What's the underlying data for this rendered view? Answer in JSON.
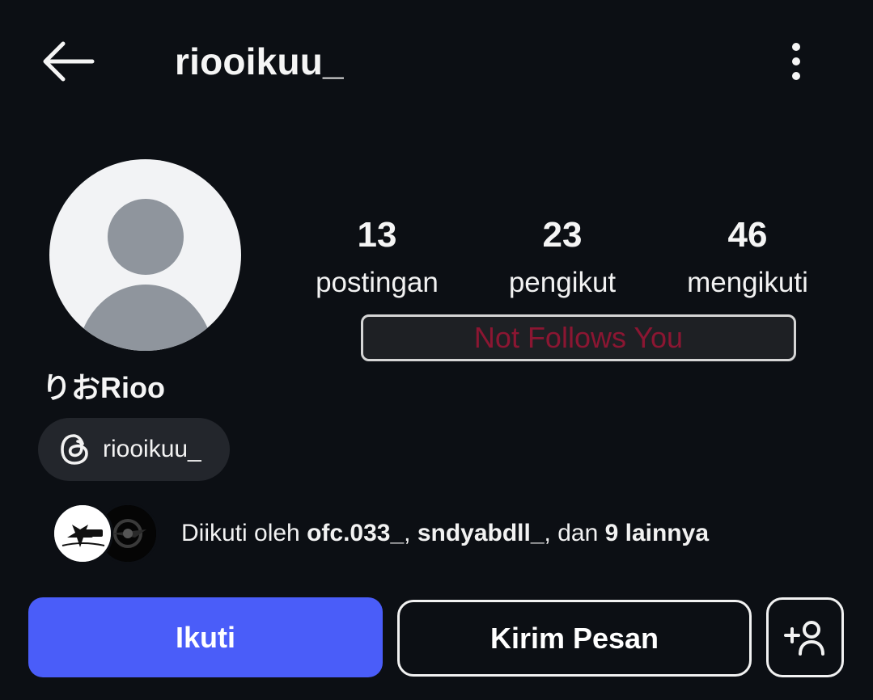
{
  "header": {
    "back_icon": "arrow-left-icon",
    "username": "riooikuu_",
    "more_icon": "vertical-ellipsis-icon"
  },
  "profile": {
    "avatar_icon": "default-avatar-icon",
    "display_name": "りおRioo",
    "threads": {
      "icon": "threads-icon",
      "handle": "riooikuu_"
    }
  },
  "stats": [
    {
      "value": "13",
      "label": "postingan"
    },
    {
      "value": "23",
      "label": "pengikut"
    },
    {
      "value": "46",
      "label": "mengikuti"
    }
  ],
  "follow_status": {
    "text": "Not Follows You",
    "color": "#8b1632"
  },
  "followed_by": {
    "prefix": "Diikuti oleh ",
    "user1": "ofc.033_",
    "sep": ", ",
    "user2": "sndyabdll_",
    "middle": ", dan ",
    "others": "9 lainnya"
  },
  "actions": {
    "follow_label": "Ikuti",
    "message_label": "Kirim Pesan",
    "add_user_icon": "add-person-icon"
  },
  "colors": {
    "background": "#0c0f14",
    "accent": "#4a5df9"
  }
}
